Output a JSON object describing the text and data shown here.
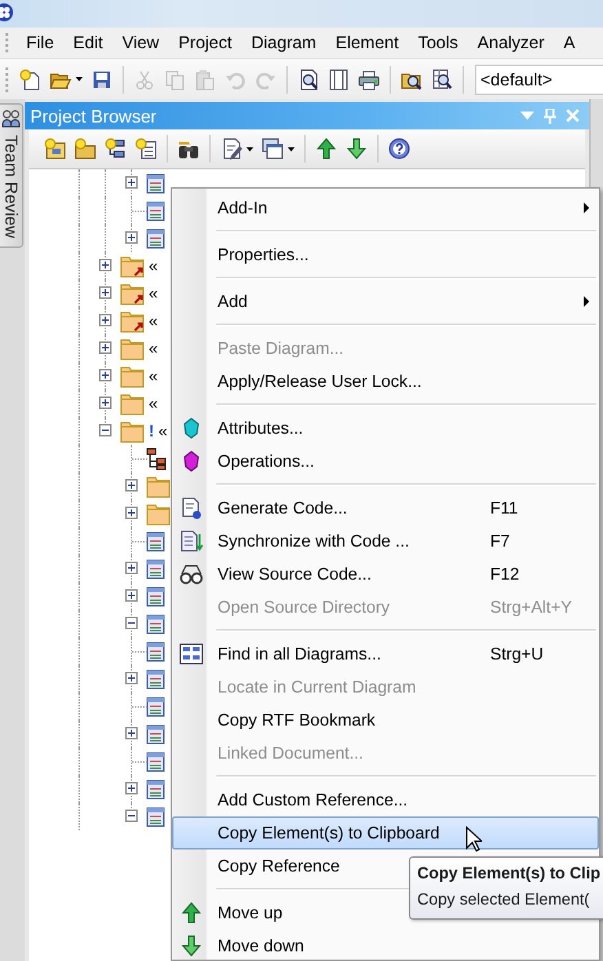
{
  "menu_bar": [
    "File",
    "Edit",
    "View",
    "Project",
    "Diagram",
    "Element",
    "Tools",
    "Analyzer",
    "A"
  ],
  "toolbar": {
    "groups": [
      [
        {
          "disabled": false,
          "has_menu": false
        },
        {
          "disabled": false,
          "has_menu": true
        },
        {
          "disabled": false,
          "has_menu": false
        }
      ],
      [
        {
          "disabled": true,
          "has_menu": false
        },
        {
          "disabled": true,
          "has_menu": false
        },
        {
          "disabled": true,
          "has_menu": false
        },
        {
          "disabled": true,
          "has_menu": false
        },
        {
          "disabled": true,
          "has_menu": false
        }
      ],
      [
        {
          "disabled": false,
          "has_menu": false
        },
        {
          "disabled": false,
          "has_menu": false
        },
        {
          "disabled": false,
          "has_menu": false
        }
      ],
      [
        {
          "disabled": false,
          "has_menu": false
        },
        {
          "disabled": false,
          "has_menu": false
        }
      ]
    ],
    "style_combo": {
      "value": "<default>"
    }
  },
  "side_tab": {
    "label": "Team Review"
  },
  "project_browser": {
    "title": "Project Browser",
    "toolbar": {
      "groups": [
        [
          {
            "has_menu": false
          },
          {
            "has_menu": false
          },
          {
            "has_menu": false
          },
          {
            "has_menu": false
          }
        ],
        [
          {
            "has_menu": false
          }
        ],
        [
          {
            "has_menu": true
          },
          {
            "has_menu": true
          }
        ],
        [
          {
            "has_menu": false
          },
          {
            "has_menu": false
          }
        ],
        [
          {
            "has_menu": false
          }
        ]
      ]
    },
    "tree": {
      "leading_rows": [
        {
          "kind": "element",
          "expandable": true,
          "expanded": false
        },
        {
          "kind": "element",
          "expandable": false
        },
        {
          "kind": "element",
          "expandable": true,
          "expanded": false
        }
      ],
      "items": [
        {
          "kind": "linked_folder",
          "expandable": true,
          "expanded": false,
          "label": "«"
        },
        {
          "kind": "linked_folder",
          "expandable": true,
          "expanded": false,
          "label": "«"
        },
        {
          "kind": "linked_folder",
          "expandable": true,
          "expanded": false,
          "label": "«"
        },
        {
          "kind": "folder",
          "expandable": true,
          "expanded": false,
          "label": "«"
        },
        {
          "kind": "folder",
          "expandable": true,
          "expanded": false,
          "label": "«"
        },
        {
          "kind": "folder",
          "expandable": true,
          "expanded": false,
          "label": "«"
        },
        {
          "kind": "folder",
          "expandable": true,
          "expanded": true,
          "flag": "!",
          "label": "«",
          "children": [
            {
              "kind": "diagram",
              "expandable": false
            },
            {
              "kind": "folder",
              "expandable": true,
              "expanded": false
            },
            {
              "kind": "folder",
              "expandable": true,
              "expanded": false
            },
            {
              "kind": "element",
              "expandable": false
            },
            {
              "kind": "element",
              "expandable": true,
              "expanded": false
            },
            {
              "kind": "element",
              "expandable": true,
              "expanded": false
            },
            {
              "kind": "element",
              "expandable": true,
              "expanded": true
            },
            {
              "kind": "element",
              "expandable": false
            },
            {
              "kind": "element",
              "expandable": true,
              "expanded": false
            },
            {
              "kind": "element",
              "expandable": false
            },
            {
              "kind": "element",
              "expandable": true,
              "expanded": false
            },
            {
              "kind": "element",
              "expandable": false
            },
            {
              "kind": "element",
              "expandable": true,
              "expanded": false
            },
            {
              "kind": "element",
              "expandable": true,
              "expanded": true
            }
          ]
        }
      ]
    }
  },
  "context_menu": {
    "items": [
      {
        "kind": "item",
        "label": "Add-In",
        "submenu": true,
        "disabled": false,
        "selected": false
      },
      {
        "kind": "separator"
      },
      {
        "kind": "item",
        "label": "Properties...",
        "submenu": false,
        "disabled": false,
        "selected": false
      },
      {
        "kind": "separator"
      },
      {
        "kind": "item",
        "label": "Add",
        "submenu": true,
        "disabled": false,
        "selected": false
      },
      {
        "kind": "separator"
      },
      {
        "kind": "item",
        "label": "Paste Diagram...",
        "submenu": false,
        "disabled": true,
        "selected": false
      },
      {
        "kind": "item",
        "label": "Apply/Release User Lock...",
        "submenu": false,
        "disabled": false,
        "selected": false
      },
      {
        "kind": "separator"
      },
      {
        "kind": "item",
        "label": "Attributes...",
        "submenu": false,
        "disabled": false,
        "selected": false
      },
      {
        "kind": "item",
        "label": "Operations...",
        "submenu": false,
        "disabled": false,
        "selected": false
      },
      {
        "kind": "separator"
      },
      {
        "kind": "item",
        "label": "Generate Code...",
        "shortcut": "F11",
        "submenu": false,
        "disabled": false,
        "selected": false
      },
      {
        "kind": "item",
        "label": "Synchronize with Code ...",
        "shortcut": "F7",
        "submenu": false,
        "disabled": false,
        "selected": false
      },
      {
        "kind": "item",
        "label": "View Source Code...",
        "shortcut": "F12",
        "submenu": false,
        "disabled": false,
        "selected": false
      },
      {
        "kind": "item",
        "label": "Open Source Directory",
        "shortcut": "Strg+Alt+Y",
        "submenu": false,
        "disabled": true,
        "selected": false
      },
      {
        "kind": "separator"
      },
      {
        "kind": "item",
        "label": "Find in all Diagrams...",
        "shortcut": "Strg+U",
        "submenu": false,
        "disabled": false,
        "selected": false
      },
      {
        "kind": "item",
        "label": "Locate in Current Diagram",
        "submenu": false,
        "disabled": true,
        "selected": false
      },
      {
        "kind": "item",
        "label": "Copy RTF Bookmark",
        "submenu": false,
        "disabled": false,
        "selected": false
      },
      {
        "kind": "item",
        "label": "Linked Document...",
        "submenu": false,
        "disabled": true,
        "selected": false
      },
      {
        "kind": "separator"
      },
      {
        "kind": "item",
        "label": "Add Custom Reference...",
        "submenu": false,
        "disabled": false,
        "selected": false
      },
      {
        "kind": "item",
        "label": "Copy Element(s) to Clipboard",
        "submenu": false,
        "disabled": false,
        "selected": true
      },
      {
        "kind": "item",
        "label": "Copy Reference",
        "submenu": false,
        "disabled": false,
        "selected": false
      },
      {
        "kind": "separator"
      },
      {
        "kind": "item",
        "label": "Move up",
        "submenu": false,
        "disabled": false,
        "selected": false
      },
      {
        "kind": "item",
        "label": "Move down",
        "submenu": false,
        "disabled": false,
        "selected": false
      }
    ]
  },
  "tooltip": {
    "title": "Copy Element(s) to Clip",
    "text": "Copy selected Element("
  }
}
